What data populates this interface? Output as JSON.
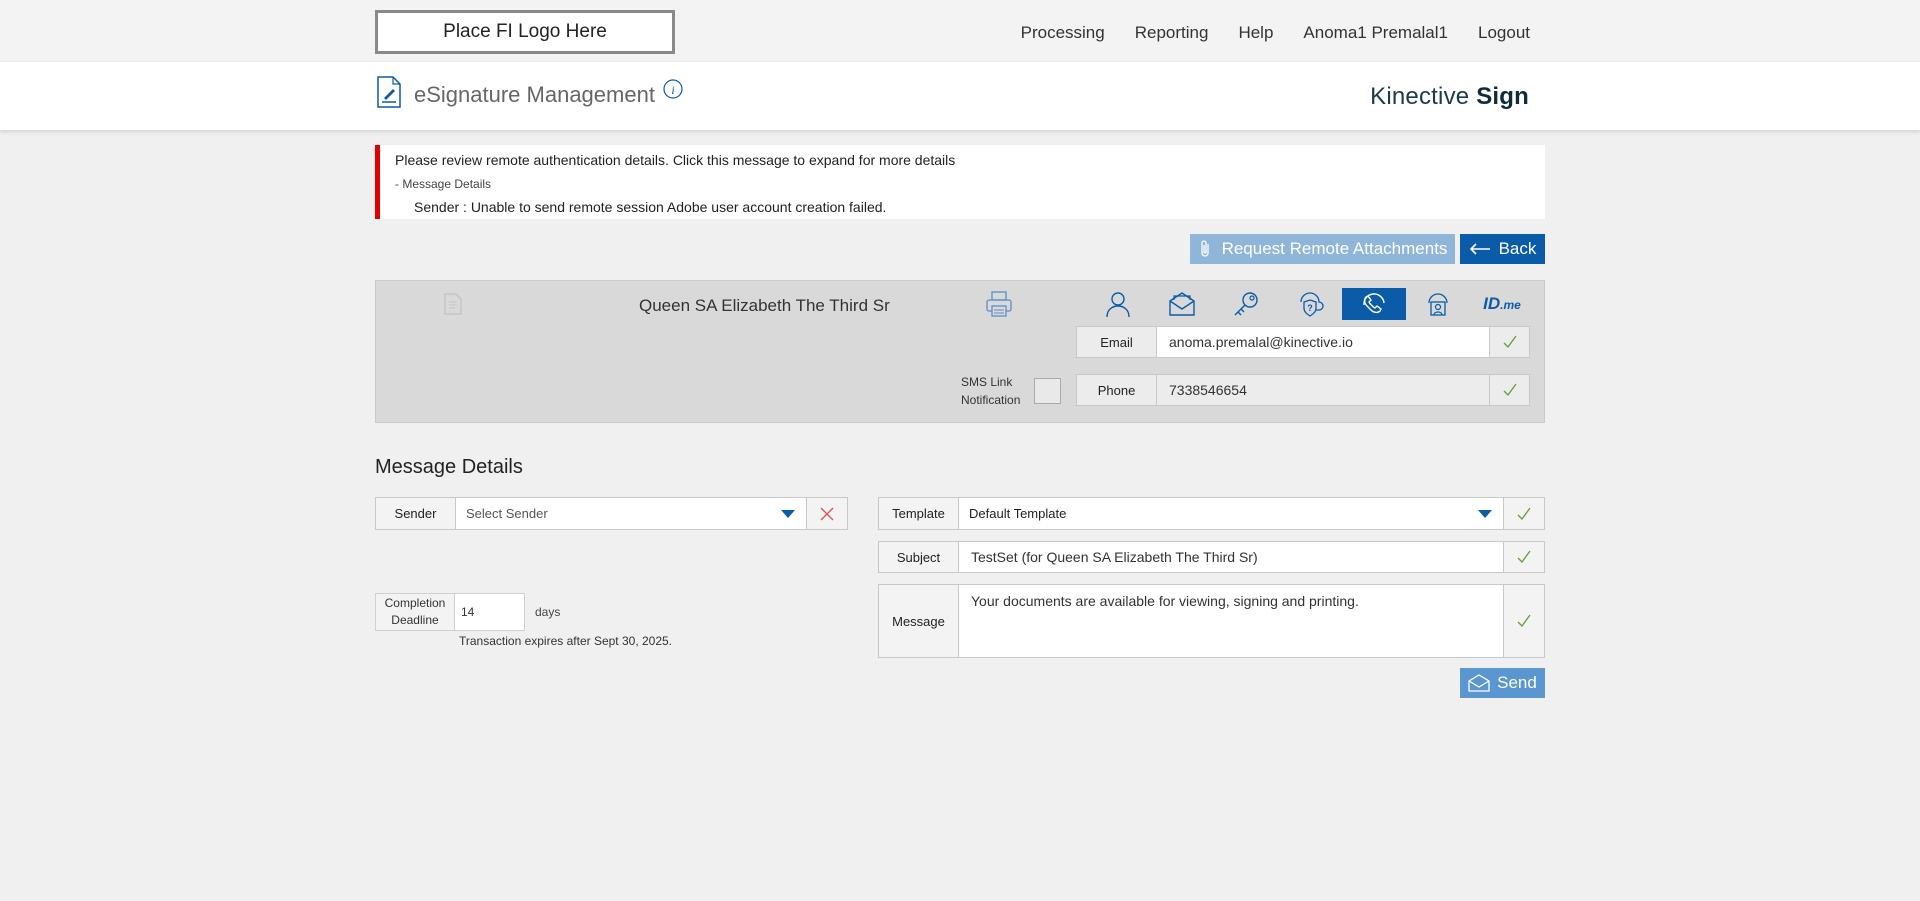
{
  "header": {
    "logo_placeholder": "Place FI Logo Here",
    "nav": [
      "Processing",
      "Reporting",
      "Help",
      "Anoma1 Premalal1",
      "Logout"
    ]
  },
  "titlebar": {
    "title": "eSignature Management",
    "brand_light": "Kinective ",
    "brand_bold": "Sign"
  },
  "alert": {
    "summary": "Please review remote authentication details. Click this message to expand for more details",
    "toggle": "- Message Details",
    "detail": "Sender :  Unable to send remote session Adobe user account creation failed."
  },
  "actions": {
    "attachments_label": "Request Remote Attachments",
    "back_label": "Back"
  },
  "signer": {
    "name": "Queen SA Elizabeth The Third Sr",
    "sms_label_line1": "SMS Link",
    "sms_label_line2": "Notification",
    "email_label": "Email",
    "email_value": "anoma.premalal@kinective.io",
    "phone_label": "Phone",
    "phone_value": "7338546654",
    "idme_label": "ID",
    "idme_suffix": ".me"
  },
  "message": {
    "section_title": "Message Details",
    "sender_label": "Sender",
    "sender_placeholder": "Select Sender",
    "deadline_label_1": "Completion",
    "deadline_label_2": "Deadline",
    "deadline_value": "14",
    "deadline_unit": "days",
    "expiry_note": "Transaction expires after Sept 30, 2025.",
    "template_label": "Template",
    "template_value": "Default Template",
    "subject_label": "Subject",
    "subject_value": "TestSet (for Queen SA Elizabeth The Third Sr)",
    "message_label": "Message",
    "message_value": "Your documents are available for viewing, signing and printing.",
    "send_label": "Send"
  },
  "colors": {
    "accent": "#0a5ca8",
    "alert_border": "#e00000",
    "check_green": "#6a9a3a"
  }
}
